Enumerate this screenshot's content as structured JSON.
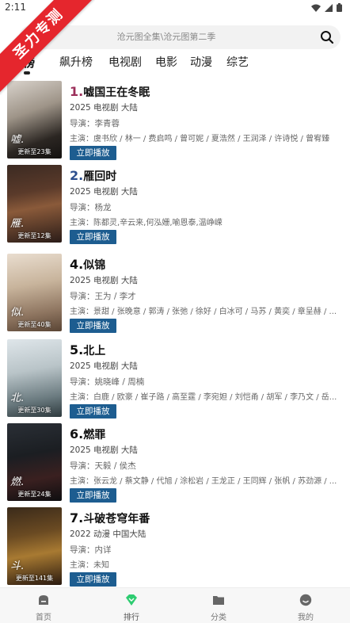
{
  "status": {
    "time": "2:11"
  },
  "ribbon": {
    "text": "圣力专测"
  },
  "search": {
    "placeholder": "沧元图全集\\沧元图第二季"
  },
  "tabs": [
    "播榜",
    "飙升榜",
    "电视剧",
    "电影",
    "动漫",
    "综艺"
  ],
  "items": [
    {
      "rank": "1.",
      "title": "嘘国王在冬眠",
      "meta": "2025 电视剧 大陆",
      "director": "导演：李青蓉",
      "cast": "主演：虞书欣 / 林一 / 费启鸣 / 曾可妮 / 夏浩然 / 王润泽 / 许诗悦 / 曾宥臻",
      "badge": "更新至23集",
      "play": "立即播放",
      "rank_color": "#9b2f5a"
    },
    {
      "rank": "2.",
      "title": "雁回时",
      "meta": "2025 电视剧 大陆",
      "director": "导演：杨龙",
      "cast": "主演：陈都灵,辛云来,何泓姗,喻恩泰,温峥嵘",
      "badge": "更新至12集",
      "play": "立即播放",
      "rank_color": "#2c4f8e"
    },
    {
      "rank": "4.",
      "title": "似锦",
      "meta": "2025 电视剧 大陆",
      "director": "导演：王为 / 李才",
      "cast": "主演：景甜 / 张晚意 / 郭涛 / 张弛 / 徐好 / 白冰可 / 马苏 / 黄奕 / 章呈赫 / ...",
      "badge": "更新至40集",
      "play": "立即播放",
      "rank_color": "#111111"
    },
    {
      "rank": "5.",
      "title": "北上",
      "meta": "2025 电视剧 大陆",
      "director": "导演：姚晓峰 / 周楠",
      "cast": "主演：白鹿 / 欧豪 / 崔子路 / 高至霆 / 李宛妲 / 刘恺甬 / 胡军 / 李乃文 / 岳...",
      "badge": "更新至30集",
      "play": "立即播放",
      "rank_color": "#111111"
    },
    {
      "rank": "6.",
      "title": "燃罪",
      "meta": "2025 电视剧 大陆",
      "director": "导演：天毅 / 侯杰",
      "cast": "主演：张云龙 / 蔡文静 / 代旭 / 涂松岩 / 王龙正 / 王同辉 / 张帆 / 苏劲源 / ...",
      "badge": "更新至24集",
      "play": "立即播放",
      "rank_color": "#111111"
    },
    {
      "rank": "7.",
      "title": "斗破苍穹年番",
      "meta": "2022 动漫 中国大陆",
      "director": "导演：内详",
      "cast": "主演：未知",
      "badge": "更新至141集",
      "play": "立即播放",
      "rank_color": "#111111"
    }
  ],
  "nav": [
    {
      "label": "首页",
      "icon": "home-icon"
    },
    {
      "label": "排行",
      "icon": "rank-icon",
      "active": true
    },
    {
      "label": "分类",
      "icon": "folder-icon"
    },
    {
      "label": "我的",
      "icon": "profile-icon"
    }
  ],
  "colors": {
    "accent": "#1d5d90",
    "active_nav": "#2ecc71",
    "ribbon": "#e5262d"
  }
}
